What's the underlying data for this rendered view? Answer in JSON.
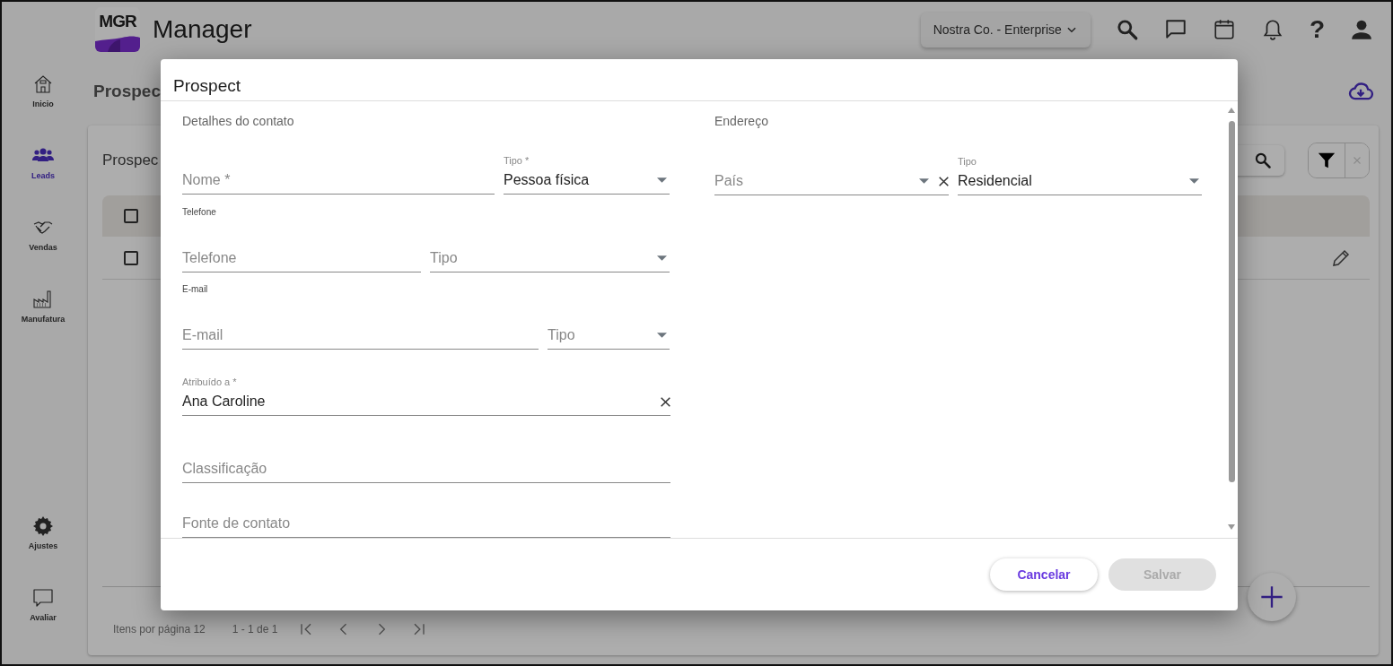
{
  "app": {
    "logo": "MGR",
    "title": "Manager"
  },
  "topbar": {
    "company": "Nostra Co. - Enterprise",
    "help_glyph": "?"
  },
  "sidebar": {
    "items": [
      {
        "label": "Inicio",
        "selected": false
      },
      {
        "label": "Leads",
        "selected": true
      },
      {
        "label": "Vendas",
        "selected": false
      },
      {
        "label": "Manufatura",
        "selected": false
      }
    ],
    "bottom_items": [
      {
        "label": "Ajustes",
        "selected": false
      },
      {
        "label": "Avaliar",
        "selected": false
      }
    ]
  },
  "page": {
    "title": "Prospec",
    "card_title": "Prospec"
  },
  "table": {
    "header_checked": false,
    "rows": [
      {
        "checked": false
      }
    ]
  },
  "pagination": {
    "items_label": "Itens por página 12",
    "range": "1 - 1 de 1"
  },
  "dialog": {
    "title": "Prospect",
    "left": {
      "heading": "Detalhes do contato",
      "rows": [
        {
          "fields": [
            {
              "kind": "text",
              "placeholder": "Nome *"
            },
            {
              "kind": "select",
              "label": "Tipo *",
              "value": "Pessoa física"
            }
          ]
        },
        {
          "group_label": "Telefone",
          "fields": [
            {
              "kind": "text",
              "placeholder": "Telefone"
            },
            {
              "kind": "select",
              "placeholder": "Tipo"
            }
          ]
        },
        {
          "group_label": "E-mail",
          "fields": [
            {
              "kind": "text",
              "placeholder": "E-mail"
            },
            {
              "kind": "select",
              "placeholder": "Tipo"
            }
          ]
        },
        {
          "fields": [
            {
              "kind": "autocomplete",
              "label": "Atribuído a *",
              "value": "Ana Caroline",
              "clearable": true
            }
          ]
        },
        {
          "fields": [
            {
              "kind": "text",
              "placeholder": "Classificação"
            }
          ]
        },
        {
          "fields": [
            {
              "kind": "text",
              "placeholder": "Fonte de contato"
            }
          ]
        }
      ]
    },
    "right": {
      "heading": "Endereço",
      "rows": [
        {
          "fields": [
            {
              "kind": "select",
              "placeholder": "País",
              "clearable": true
            },
            {
              "kind": "select",
              "label": "Tipo",
              "value": "Residencial"
            }
          ]
        }
      ]
    },
    "buttons": [
      {
        "label": "Cancelar",
        "disabled": false
      },
      {
        "label": "Salvar",
        "disabled": true
      }
    ]
  }
}
